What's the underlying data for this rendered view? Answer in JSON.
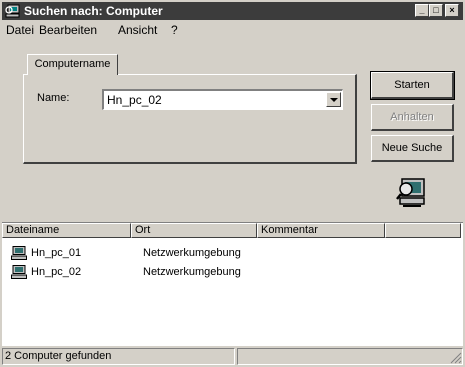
{
  "window": {
    "title": "Suchen nach: Computer",
    "controls": {
      "minimize": "_",
      "maximize": "□",
      "close": "×"
    }
  },
  "menu": [
    "Datei",
    "Bearbeiten",
    "Ansicht",
    "?"
  ],
  "tab": {
    "label": "Computername"
  },
  "form": {
    "name_label": "Name:",
    "name_value": "Hn_pc_02"
  },
  "buttons": {
    "start": "Starten",
    "stop": "Anhalten",
    "new_search": "Neue Suche"
  },
  "results": {
    "columns": [
      "Dateiname",
      "Ort",
      "Kommentar",
      ""
    ],
    "rows": [
      {
        "name": "Hn_pc_01",
        "location": "Netzwerkumgebung",
        "comment": ""
      },
      {
        "name": "Hn_pc_02",
        "location": "Netzwerkumgebung",
        "comment": ""
      }
    ]
  },
  "status": {
    "text": "2 Computer gefunden",
    "second": ""
  },
  "icons": {
    "app": "find-computer-icon",
    "search_animation": "find-computer-icon",
    "row": "computer-icon"
  }
}
